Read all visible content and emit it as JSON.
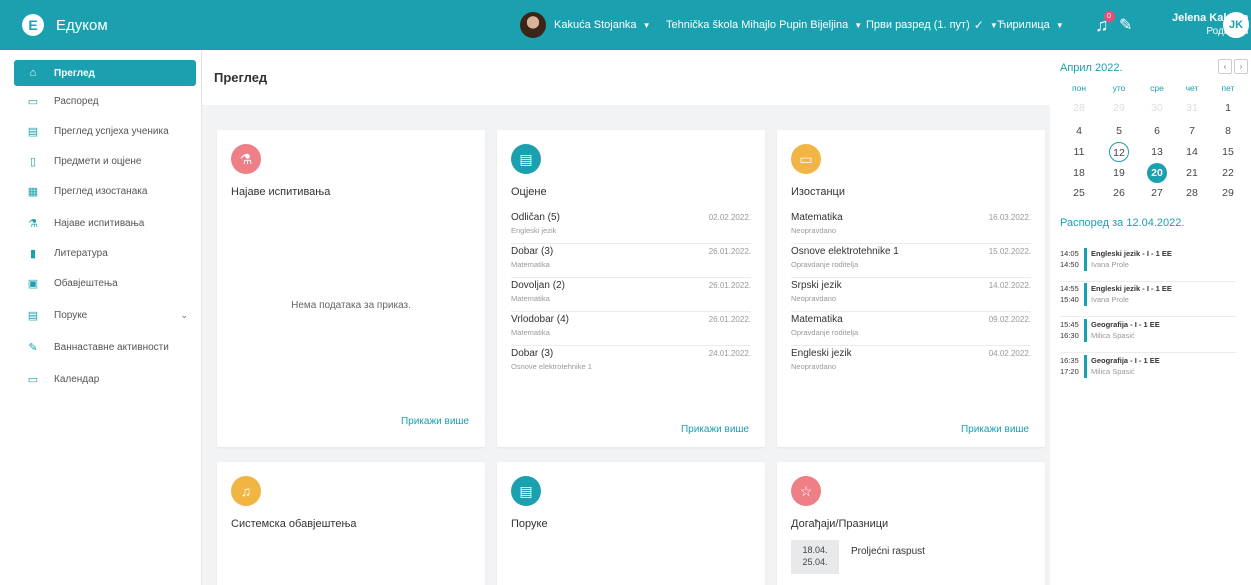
{
  "app": {
    "logo_glyph": "E",
    "name": "Едуком"
  },
  "header": {
    "student": "Kakuća Stojanka",
    "school": "Tehnička škola Mihajlo Pupin Bijeljina",
    "grade": "Први разред (1. пут)",
    "script": "Ћирилица",
    "notification_count": "0",
    "user_name": "Jelena Kakuća",
    "user_role": "Родитељ",
    "user_initials": "JK",
    "accent_color": "#1ba0b0"
  },
  "sidebar": {
    "items": [
      {
        "label": "Преглед",
        "icon": "home-icon"
      },
      {
        "label": "Распоред",
        "icon": "calendar-icon"
      },
      {
        "label": "Преглед успјеха ученика",
        "icon": "report-icon"
      },
      {
        "label": "Предмети и оцјене",
        "icon": "document-icon"
      },
      {
        "label": "Преглед изостанака",
        "icon": "absence-icon"
      },
      {
        "label": "Најаве испитивања",
        "icon": "flask-icon"
      },
      {
        "label": "Литература",
        "icon": "book-icon"
      },
      {
        "label": "Обавјештења",
        "icon": "announcement-icon"
      },
      {
        "label": "Поруке",
        "icon": "message-icon"
      },
      {
        "label": "Ваннаставне активности",
        "icon": "pencil-icon"
      },
      {
        "label": "Календар",
        "icon": "calendar-icon"
      }
    ]
  },
  "main": {
    "title": "Преглед",
    "more_label": "Прикажи више",
    "exams": {
      "title": "Најаве испитивања",
      "empty": "Нема података за приказ.",
      "color": "#ee7f87"
    },
    "grades": {
      "title": "Оцјене",
      "color": "#1ba0b0",
      "items": [
        {
          "title": "Odličan (5)",
          "sub": "Engleski jezik",
          "date": "02.02.2022."
        },
        {
          "title": "Dobar (3)",
          "sub": "Matematika",
          "date": "26.01.2022."
        },
        {
          "title": "Dovoljan (2)",
          "sub": "Matematika",
          "date": "26.01.2022."
        },
        {
          "title": "Vrlodobar (4)",
          "sub": "Matematika",
          "date": "26.01.2022."
        },
        {
          "title": "Dobar (3)",
          "sub": "Osnove elektrotehnike 1",
          "date": "24.01.2022."
        }
      ]
    },
    "absences": {
      "title": "Изостанци",
      "color": "#f0b542",
      "items": [
        {
          "title": "Matematika",
          "sub": "Neopravdano",
          "date": "16.03.2022."
        },
        {
          "title": "Osnove elektrotehnike 1",
          "sub": "Opravdanje roditelja",
          "date": "15.02.2022."
        },
        {
          "title": "Srpski jezik",
          "sub": "Neopravdano",
          "date": "14.02.2022."
        },
        {
          "title": "Matematika",
          "sub": "Opravdanje roditelja",
          "date": "09.02.2022."
        },
        {
          "title": "Engleski jezik",
          "sub": "Neopravdano",
          "date": "04.02.2022."
        }
      ]
    },
    "system": {
      "title": "Системска обавјештења",
      "color": "#f0b542"
    },
    "messages": {
      "title": "Поруке",
      "color": "#1ba0b0"
    },
    "events": {
      "title": "Догађаји/Празници",
      "color": "#ee7f87",
      "items": [
        {
          "from": "18.04.",
          "to": "25.04.",
          "name": "Proljećni raspust"
        }
      ]
    }
  },
  "calendar": {
    "title": "Април 2022.",
    "weekdays": [
      "пон",
      "уто",
      "сре",
      "чет",
      "пет"
    ],
    "weeks": [
      [
        "28",
        "29",
        "30",
        "31",
        "1"
      ],
      [
        "4",
        "5",
        "6",
        "7",
        "8"
      ],
      [
        "11",
        "12",
        "13",
        "14",
        "15"
      ],
      [
        "18",
        "19",
        "20",
        "21",
        "22"
      ],
      [
        "25",
        "26",
        "27",
        "28",
        "29"
      ]
    ],
    "selected_day": "12",
    "today": "20"
  },
  "schedule": {
    "title": "Распоред за 12.04.2022.",
    "items": [
      {
        "start": "14:05",
        "end": "14:50",
        "subject": "Engleski jezik - I - 1 EE",
        "teacher": "Ivana Prole"
      },
      {
        "start": "14:55",
        "end": "15:40",
        "subject": "Engleski jezik - I - 1 EE",
        "teacher": "Ivana Prole"
      },
      {
        "start": "15:45",
        "end": "16:30",
        "subject": "Geografija - I - 1 EE",
        "teacher": "Milica Spasić"
      },
      {
        "start": "16:35",
        "end": "17:20",
        "subject": "Geografija - I - 1 EE",
        "teacher": "Milica Spasić"
      }
    ]
  }
}
